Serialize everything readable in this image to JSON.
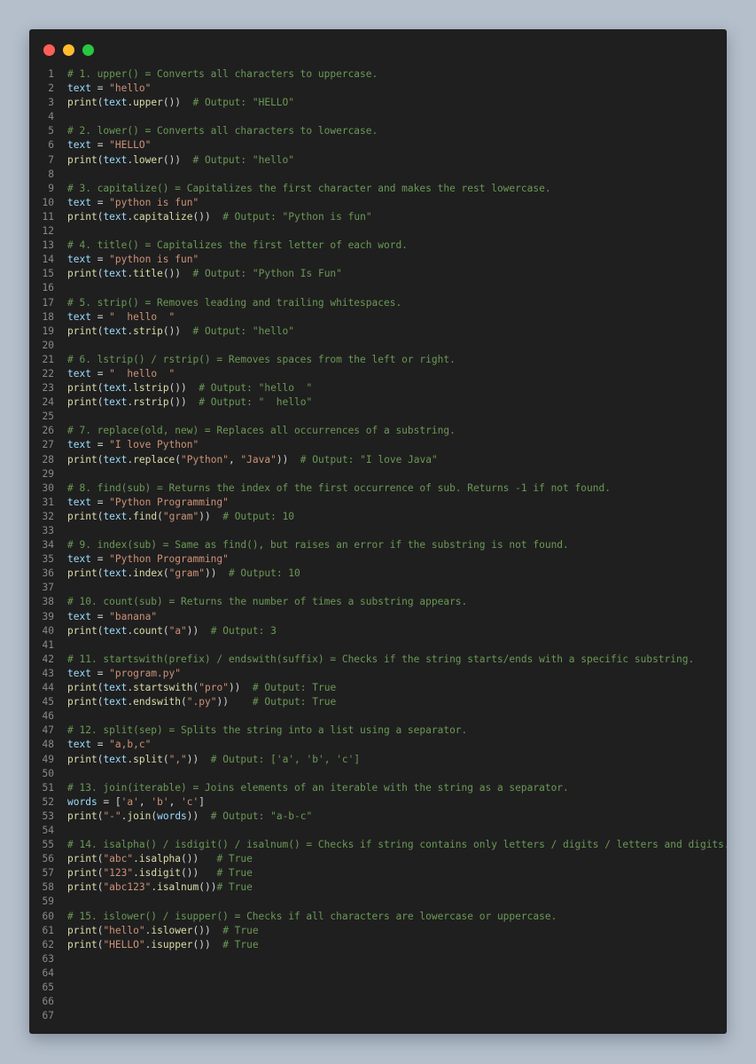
{
  "window": {
    "controls": {
      "close_color": "#ff5f57",
      "minimize_color": "#febc2e",
      "maximize_color": "#28c840"
    }
  },
  "colors": {
    "background": "#b4bfcb",
    "editor": "#1f1f1f",
    "comment": "#6a9955",
    "function": "#dcdcaa",
    "variable": "#9cdcfe",
    "string": "#ce9178",
    "plain": "#d4d4d4",
    "line_number": "#8a8a8a"
  },
  "lines": [
    {
      "n": "1",
      "tokens": [
        {
          "t": "cm",
          "v": "# 1. upper() = Converts all characters to uppercase."
        }
      ]
    },
    {
      "n": "2",
      "tokens": [
        {
          "t": "var",
          "v": "text"
        },
        {
          "t": "op",
          "v": " = "
        },
        {
          "t": "str",
          "v": "\"hello\""
        }
      ]
    },
    {
      "n": "3",
      "tokens": [
        {
          "t": "fn",
          "v": "print"
        },
        {
          "t": "pn",
          "v": "("
        },
        {
          "t": "var",
          "v": "text"
        },
        {
          "t": "pn",
          "v": "."
        },
        {
          "t": "fn",
          "v": "upper"
        },
        {
          "t": "pn",
          "v": "())  "
        },
        {
          "t": "cm",
          "v": "# Output: \"HELLO\""
        }
      ]
    },
    {
      "n": "4",
      "tokens": []
    },
    {
      "n": "5",
      "tokens": [
        {
          "t": "cm",
          "v": "# 2. lower() = Converts all characters to lowercase."
        }
      ]
    },
    {
      "n": "6",
      "tokens": [
        {
          "t": "var",
          "v": "text"
        },
        {
          "t": "op",
          "v": " = "
        },
        {
          "t": "str",
          "v": "\"HELLO\""
        }
      ]
    },
    {
      "n": "7",
      "tokens": [
        {
          "t": "fn",
          "v": "print"
        },
        {
          "t": "pn",
          "v": "("
        },
        {
          "t": "var",
          "v": "text"
        },
        {
          "t": "pn",
          "v": "."
        },
        {
          "t": "fn",
          "v": "lower"
        },
        {
          "t": "pn",
          "v": "())  "
        },
        {
          "t": "cm",
          "v": "# Output: \"hello\""
        }
      ]
    },
    {
      "n": "8",
      "tokens": []
    },
    {
      "n": "9",
      "tokens": [
        {
          "t": "cm",
          "v": "# 3. capitalize() = Capitalizes the first character and makes the rest lowercase."
        }
      ]
    },
    {
      "n": "10",
      "tokens": [
        {
          "t": "var",
          "v": "text"
        },
        {
          "t": "op",
          "v": " = "
        },
        {
          "t": "str",
          "v": "\"python is fun\""
        }
      ]
    },
    {
      "n": "11",
      "tokens": [
        {
          "t": "fn",
          "v": "print"
        },
        {
          "t": "pn",
          "v": "("
        },
        {
          "t": "var",
          "v": "text"
        },
        {
          "t": "pn",
          "v": "."
        },
        {
          "t": "fn",
          "v": "capitalize"
        },
        {
          "t": "pn",
          "v": "())  "
        },
        {
          "t": "cm",
          "v": "# Output: \"Python is fun\""
        }
      ]
    },
    {
      "n": "12",
      "tokens": []
    },
    {
      "n": "13",
      "tokens": [
        {
          "t": "cm",
          "v": "# 4. title() = Capitalizes the first letter of each word."
        }
      ]
    },
    {
      "n": "14",
      "tokens": [
        {
          "t": "var",
          "v": "text"
        },
        {
          "t": "op",
          "v": " = "
        },
        {
          "t": "str",
          "v": "\"python is fun\""
        }
      ]
    },
    {
      "n": "15",
      "tokens": [
        {
          "t": "fn",
          "v": "print"
        },
        {
          "t": "pn",
          "v": "("
        },
        {
          "t": "var",
          "v": "text"
        },
        {
          "t": "pn",
          "v": "."
        },
        {
          "t": "fn",
          "v": "title"
        },
        {
          "t": "pn",
          "v": "())  "
        },
        {
          "t": "cm",
          "v": "# Output: \"Python Is Fun\""
        }
      ]
    },
    {
      "n": "16",
      "tokens": []
    },
    {
      "n": "17",
      "tokens": [
        {
          "t": "cm",
          "v": "# 5. strip() = Removes leading and trailing whitespaces."
        }
      ]
    },
    {
      "n": "18",
      "tokens": [
        {
          "t": "var",
          "v": "text"
        },
        {
          "t": "op",
          "v": " = "
        },
        {
          "t": "str",
          "v": "\"  hello  \""
        }
      ]
    },
    {
      "n": "19",
      "tokens": [
        {
          "t": "fn",
          "v": "print"
        },
        {
          "t": "pn",
          "v": "("
        },
        {
          "t": "var",
          "v": "text"
        },
        {
          "t": "pn",
          "v": "."
        },
        {
          "t": "fn",
          "v": "strip"
        },
        {
          "t": "pn",
          "v": "())  "
        },
        {
          "t": "cm",
          "v": "# Output: \"hello\""
        }
      ]
    },
    {
      "n": "20",
      "tokens": []
    },
    {
      "n": "21",
      "tokens": [
        {
          "t": "cm",
          "v": "# 6. lstrip() / rstrip() = Removes spaces from the left or right."
        }
      ]
    },
    {
      "n": "22",
      "tokens": [
        {
          "t": "var",
          "v": "text"
        },
        {
          "t": "op",
          "v": " = "
        },
        {
          "t": "str",
          "v": "\"  hello  \""
        }
      ]
    },
    {
      "n": "23",
      "tokens": [
        {
          "t": "fn",
          "v": "print"
        },
        {
          "t": "pn",
          "v": "("
        },
        {
          "t": "var",
          "v": "text"
        },
        {
          "t": "pn",
          "v": "."
        },
        {
          "t": "fn",
          "v": "lstrip"
        },
        {
          "t": "pn",
          "v": "())  "
        },
        {
          "t": "cm",
          "v": "# Output: \"hello  \""
        }
      ]
    },
    {
      "n": "24",
      "tokens": [
        {
          "t": "fn",
          "v": "print"
        },
        {
          "t": "pn",
          "v": "("
        },
        {
          "t": "var",
          "v": "text"
        },
        {
          "t": "pn",
          "v": "."
        },
        {
          "t": "fn",
          "v": "rstrip"
        },
        {
          "t": "pn",
          "v": "())  "
        },
        {
          "t": "cm",
          "v": "# Output: \"  hello\""
        }
      ]
    },
    {
      "n": "25",
      "tokens": []
    },
    {
      "n": "26",
      "tokens": [
        {
          "t": "cm",
          "v": "# 7. replace(old, new) = Replaces all occurrences of a substring."
        }
      ]
    },
    {
      "n": "27",
      "tokens": [
        {
          "t": "var",
          "v": "text"
        },
        {
          "t": "op",
          "v": " = "
        },
        {
          "t": "str",
          "v": "\"I love Python\""
        }
      ]
    },
    {
      "n": "28",
      "tokens": [
        {
          "t": "fn",
          "v": "print"
        },
        {
          "t": "pn",
          "v": "("
        },
        {
          "t": "var",
          "v": "text"
        },
        {
          "t": "pn",
          "v": "."
        },
        {
          "t": "fn",
          "v": "replace"
        },
        {
          "t": "pn",
          "v": "("
        },
        {
          "t": "str",
          "v": "\"Python\""
        },
        {
          "t": "pn",
          "v": ", "
        },
        {
          "t": "str",
          "v": "\"Java\""
        },
        {
          "t": "pn",
          "v": "))  "
        },
        {
          "t": "cm",
          "v": "# Output: \"I love Java\""
        }
      ]
    },
    {
      "n": "29",
      "tokens": []
    },
    {
      "n": "30",
      "tokens": [
        {
          "t": "cm",
          "v": "# 8. find(sub) = Returns the index of the first occurrence of sub. Returns -1 if not found."
        }
      ]
    },
    {
      "n": "31",
      "tokens": [
        {
          "t": "var",
          "v": "text"
        },
        {
          "t": "op",
          "v": " = "
        },
        {
          "t": "str",
          "v": "\"Python Programming\""
        }
      ]
    },
    {
      "n": "32",
      "tokens": [
        {
          "t": "fn",
          "v": "print"
        },
        {
          "t": "pn",
          "v": "("
        },
        {
          "t": "var",
          "v": "text"
        },
        {
          "t": "pn",
          "v": "."
        },
        {
          "t": "fn",
          "v": "find"
        },
        {
          "t": "pn",
          "v": "("
        },
        {
          "t": "str",
          "v": "\"gram\""
        },
        {
          "t": "pn",
          "v": "))  "
        },
        {
          "t": "cm",
          "v": "# Output: 10"
        }
      ]
    },
    {
      "n": "33",
      "tokens": []
    },
    {
      "n": "34",
      "tokens": [
        {
          "t": "cm",
          "v": "# 9. index(sub) = Same as find(), but raises an error if the substring is not found."
        }
      ]
    },
    {
      "n": "35",
      "tokens": [
        {
          "t": "var",
          "v": "text"
        },
        {
          "t": "op",
          "v": " = "
        },
        {
          "t": "str",
          "v": "\"Python Programming\""
        }
      ]
    },
    {
      "n": "36",
      "tokens": [
        {
          "t": "fn",
          "v": "print"
        },
        {
          "t": "pn",
          "v": "("
        },
        {
          "t": "var",
          "v": "text"
        },
        {
          "t": "pn",
          "v": "."
        },
        {
          "t": "fn",
          "v": "index"
        },
        {
          "t": "pn",
          "v": "("
        },
        {
          "t": "str",
          "v": "\"gram\""
        },
        {
          "t": "pn",
          "v": "))  "
        },
        {
          "t": "cm",
          "v": "# Output: 10"
        }
      ]
    },
    {
      "n": "37",
      "tokens": []
    },
    {
      "n": "38",
      "tokens": [
        {
          "t": "cm",
          "v": "# 10. count(sub) = Returns the number of times a substring appears."
        }
      ]
    },
    {
      "n": "39",
      "tokens": [
        {
          "t": "var",
          "v": "text"
        },
        {
          "t": "op",
          "v": " = "
        },
        {
          "t": "str",
          "v": "\"banana\""
        }
      ]
    },
    {
      "n": "40",
      "tokens": [
        {
          "t": "fn",
          "v": "print"
        },
        {
          "t": "pn",
          "v": "("
        },
        {
          "t": "var",
          "v": "text"
        },
        {
          "t": "pn",
          "v": "."
        },
        {
          "t": "fn",
          "v": "count"
        },
        {
          "t": "pn",
          "v": "("
        },
        {
          "t": "str",
          "v": "\"a\""
        },
        {
          "t": "pn",
          "v": "))  "
        },
        {
          "t": "cm",
          "v": "# Output: 3"
        }
      ]
    },
    {
      "n": "41",
      "tokens": []
    },
    {
      "n": "42",
      "tokens": [
        {
          "t": "cm",
          "v": "# 11. startswith(prefix) / endswith(suffix) = Checks if the string starts/ends with a specific substring."
        }
      ]
    },
    {
      "n": "43",
      "tokens": [
        {
          "t": "var",
          "v": "text"
        },
        {
          "t": "op",
          "v": " = "
        },
        {
          "t": "str",
          "v": "\"program.py\""
        }
      ]
    },
    {
      "n": "44",
      "tokens": [
        {
          "t": "fn",
          "v": "print"
        },
        {
          "t": "pn",
          "v": "("
        },
        {
          "t": "var",
          "v": "text"
        },
        {
          "t": "pn",
          "v": "."
        },
        {
          "t": "fn",
          "v": "startswith"
        },
        {
          "t": "pn",
          "v": "("
        },
        {
          "t": "str",
          "v": "\"pro\""
        },
        {
          "t": "pn",
          "v": "))  "
        },
        {
          "t": "cm",
          "v": "# Output: True"
        }
      ]
    },
    {
      "n": "45",
      "tokens": [
        {
          "t": "fn",
          "v": "print"
        },
        {
          "t": "pn",
          "v": "("
        },
        {
          "t": "var",
          "v": "text"
        },
        {
          "t": "pn",
          "v": "."
        },
        {
          "t": "fn",
          "v": "endswith"
        },
        {
          "t": "pn",
          "v": "("
        },
        {
          "t": "str",
          "v": "\".py\""
        },
        {
          "t": "pn",
          "v": "))    "
        },
        {
          "t": "cm",
          "v": "# Output: True"
        }
      ]
    },
    {
      "n": "46",
      "tokens": []
    },
    {
      "n": "47",
      "tokens": [
        {
          "t": "cm",
          "v": "# 12. split(sep) = Splits the string into a list using a separator."
        }
      ]
    },
    {
      "n": "48",
      "tokens": [
        {
          "t": "var",
          "v": "text"
        },
        {
          "t": "op",
          "v": " = "
        },
        {
          "t": "str",
          "v": "\"a,b,c\""
        }
      ]
    },
    {
      "n": "49",
      "tokens": [
        {
          "t": "fn",
          "v": "print"
        },
        {
          "t": "pn",
          "v": "("
        },
        {
          "t": "var",
          "v": "text"
        },
        {
          "t": "pn",
          "v": "."
        },
        {
          "t": "fn",
          "v": "split"
        },
        {
          "t": "pn",
          "v": "("
        },
        {
          "t": "str",
          "v": "\",\""
        },
        {
          "t": "pn",
          "v": "))  "
        },
        {
          "t": "cm",
          "v": "# Output: ['a', 'b', 'c']"
        }
      ]
    },
    {
      "n": "50",
      "tokens": []
    },
    {
      "n": "51",
      "tokens": [
        {
          "t": "cm",
          "v": "# 13. join(iterable) = Joins elements of an iterable with the string as a separator."
        }
      ]
    },
    {
      "n": "52",
      "tokens": [
        {
          "t": "var",
          "v": "words"
        },
        {
          "t": "op",
          "v": " = "
        },
        {
          "t": "pn",
          "v": "["
        },
        {
          "t": "str",
          "v": "'a'"
        },
        {
          "t": "pn",
          "v": ", "
        },
        {
          "t": "str",
          "v": "'b'"
        },
        {
          "t": "pn",
          "v": ", "
        },
        {
          "t": "str",
          "v": "'c'"
        },
        {
          "t": "pn",
          "v": "]"
        }
      ]
    },
    {
      "n": "53",
      "tokens": [
        {
          "t": "fn",
          "v": "print"
        },
        {
          "t": "pn",
          "v": "("
        },
        {
          "t": "str",
          "v": "\"-\""
        },
        {
          "t": "pn",
          "v": "."
        },
        {
          "t": "fn",
          "v": "join"
        },
        {
          "t": "pn",
          "v": "("
        },
        {
          "t": "var",
          "v": "words"
        },
        {
          "t": "pn",
          "v": "))  "
        },
        {
          "t": "cm",
          "v": "# Output: \"a-b-c\""
        }
      ]
    },
    {
      "n": "54",
      "tokens": []
    },
    {
      "n": "55",
      "tokens": [
        {
          "t": "cm",
          "v": "# 14. isalpha() / isdigit() / isalnum() = Checks if string contains only letters / digits / letters and digits."
        }
      ]
    },
    {
      "n": "56",
      "tokens": [
        {
          "t": "fn",
          "v": "print"
        },
        {
          "t": "pn",
          "v": "("
        },
        {
          "t": "str",
          "v": "\"abc\""
        },
        {
          "t": "pn",
          "v": "."
        },
        {
          "t": "fn",
          "v": "isalpha"
        },
        {
          "t": "pn",
          "v": "())   "
        },
        {
          "t": "cm",
          "v": "# True"
        }
      ]
    },
    {
      "n": "57",
      "tokens": [
        {
          "t": "fn",
          "v": "print"
        },
        {
          "t": "pn",
          "v": "("
        },
        {
          "t": "str",
          "v": "\"123\""
        },
        {
          "t": "pn",
          "v": "."
        },
        {
          "t": "fn",
          "v": "isdigit"
        },
        {
          "t": "pn",
          "v": "())   "
        },
        {
          "t": "cm",
          "v": "# True"
        }
      ]
    },
    {
      "n": "58",
      "tokens": [
        {
          "t": "fn",
          "v": "print"
        },
        {
          "t": "pn",
          "v": "("
        },
        {
          "t": "str",
          "v": "\"abc123\""
        },
        {
          "t": "pn",
          "v": "."
        },
        {
          "t": "fn",
          "v": "isalnum"
        },
        {
          "t": "pn",
          "v": "())"
        },
        {
          "t": "cm",
          "v": "# True"
        }
      ]
    },
    {
      "n": "59",
      "tokens": []
    },
    {
      "n": "60",
      "tokens": [
        {
          "t": "cm",
          "v": "# 15. islower() / isupper() = Checks if all characters are lowercase or uppercase."
        }
      ]
    },
    {
      "n": "61",
      "tokens": [
        {
          "t": "fn",
          "v": "print"
        },
        {
          "t": "pn",
          "v": "("
        },
        {
          "t": "str",
          "v": "\"hello\""
        },
        {
          "t": "pn",
          "v": "."
        },
        {
          "t": "fn",
          "v": "islower"
        },
        {
          "t": "pn",
          "v": "())  "
        },
        {
          "t": "cm",
          "v": "# True"
        }
      ]
    },
    {
      "n": "62",
      "tokens": [
        {
          "t": "fn",
          "v": "print"
        },
        {
          "t": "pn",
          "v": "("
        },
        {
          "t": "str",
          "v": "\"HELLO\""
        },
        {
          "t": "pn",
          "v": "."
        },
        {
          "t": "fn",
          "v": "isupper"
        },
        {
          "t": "pn",
          "v": "())  "
        },
        {
          "t": "cm",
          "v": "# True"
        }
      ]
    },
    {
      "n": "63",
      "tokens": []
    },
    {
      "n": "64",
      "tokens": []
    },
    {
      "n": "65",
      "tokens": []
    },
    {
      "n": "66",
      "tokens": []
    },
    {
      "n": "67",
      "tokens": []
    }
  ]
}
